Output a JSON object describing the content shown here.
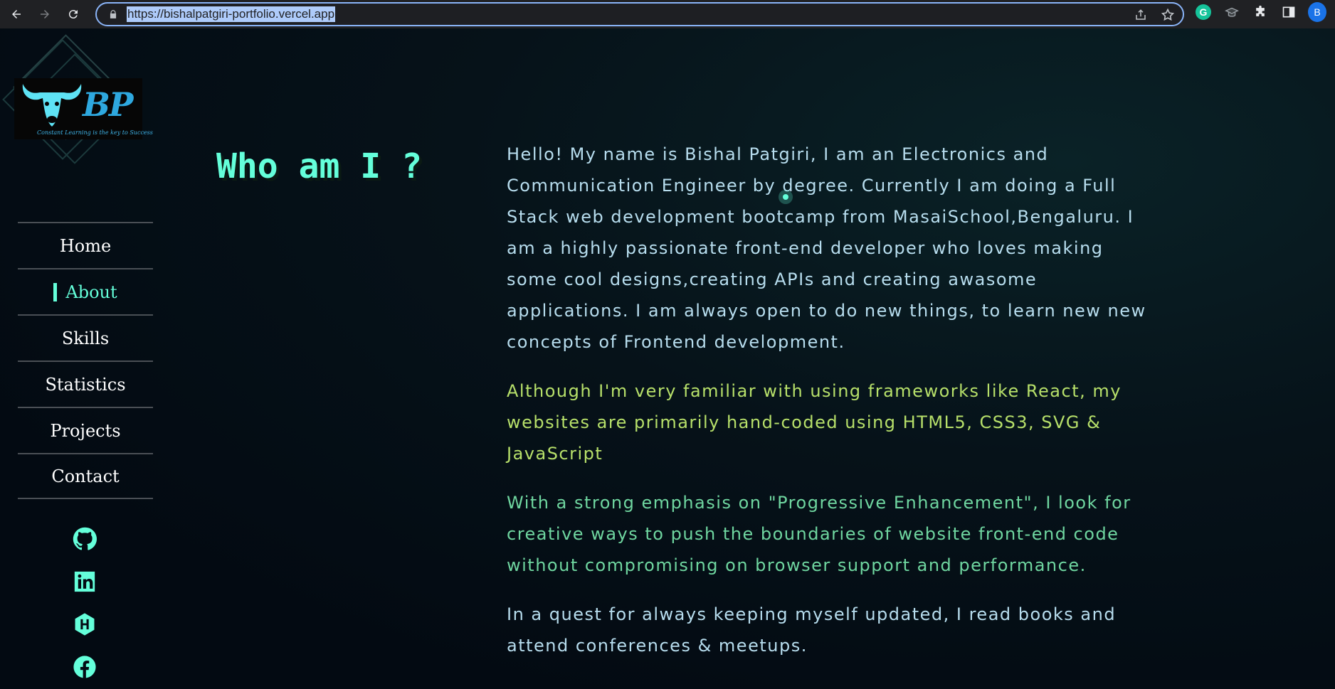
{
  "browser": {
    "url": "https://bishalpatgiri-portfolio.vercel.app",
    "profile_initial": "B",
    "grammarly_label": "G"
  },
  "logo": {
    "initials": "BP",
    "tagline": "Constant Learning is the key to Success"
  },
  "sidebar": {
    "items": [
      {
        "label": "Home",
        "active": false
      },
      {
        "label": "About",
        "active": true
      },
      {
        "label": "Skills",
        "active": false
      },
      {
        "label": "Statistics",
        "active": false
      },
      {
        "label": "Projects",
        "active": false
      },
      {
        "label": "Contact",
        "active": false
      }
    ],
    "socials": [
      "github-icon",
      "linkedin-icon",
      "hashnode-icon",
      "facebook-icon"
    ]
  },
  "about": {
    "heading": "Who am I ?",
    "paragraphs": [
      "Hello! My name is Bishal Patgiri, I am an Electronics and Communication Engineer by degree. Currently I am doing a Full Stack web development bootcamp from MasaiSchool,Bengaluru. I am a highly passionate front-end developer who loves making some cool designs,creating APIs and creating awasome applications. I am always open to do new things, to learn new new concepts of Frontend development.",
      "Although I'm very familiar with using frameworks like React, my websites are primarily hand-coded using HTML5, CSS3, SVG & JavaScript",
      "With a strong emphasis on \"Progressive Enhancement\", I look for creative ways to push the boundaries of website front-end code without compromising on browser support and performance.",
      "In a quest for always keeping myself updated, I read books and attend conferences & meetups."
    ]
  },
  "colors": {
    "accent": "#64ffda",
    "paragraph_primary": "#b7ddee",
    "paragraph_lime": "#b7e06a",
    "paragraph_green": "#6fd6a0"
  }
}
